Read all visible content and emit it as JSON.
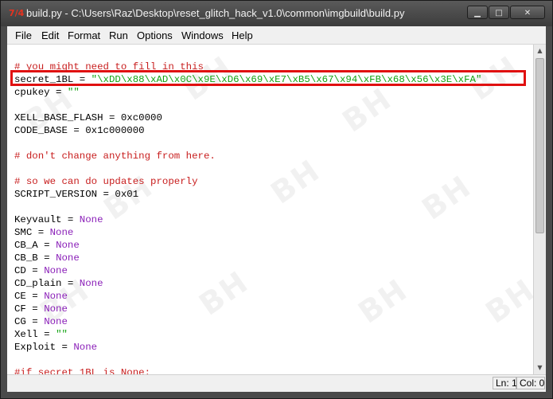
{
  "window": {
    "app_icon": "7/4",
    "title": "build.py - C:\\Users\\Raz\\Desktop\\reset_glitch_hack_v1.0\\common\\imgbuild\\build.py",
    "min_glyph": "▁",
    "max_glyph": "□",
    "close_glyph": "✕"
  },
  "menu": {
    "items": [
      "File",
      "Edit",
      "Format",
      "Run",
      "Options",
      "Windows",
      "Help"
    ]
  },
  "editor": {
    "lines": [
      [
        {
          "t": "# you might need to fill in this",
          "c": "com"
        }
      ],
      [
        {
          "t": "secret_1BL = ",
          "c": "def"
        },
        {
          "t": "\"\\xDD\\x88\\xAD\\x0C\\x9E\\xD6\\x69\\xE7\\xB5\\x67\\x94\\xFB\\x68\\x56\\x3E\\xFA\"",
          "c": "str"
        }
      ],
      [
        {
          "t": "cpukey = ",
          "c": "def"
        },
        {
          "t": "\"\"",
          "c": "str"
        }
      ],
      [],
      [
        {
          "t": "XELL_BASE_FLASH = 0xc0000",
          "c": "def"
        }
      ],
      [
        {
          "t": "CODE_BASE = 0x1c000000",
          "c": "def"
        }
      ],
      [],
      [
        {
          "t": "# don't change anything from here.",
          "c": "com"
        }
      ],
      [],
      [
        {
          "t": "# so we can do updates properly",
          "c": "com"
        }
      ],
      [
        {
          "t": "SCRIPT_VERSION = 0x01",
          "c": "def"
        }
      ],
      [],
      [
        {
          "t": "Keyvault = ",
          "c": "def"
        },
        {
          "t": "None",
          "c": "kw"
        }
      ],
      [
        {
          "t": "SMC = ",
          "c": "def"
        },
        {
          "t": "None",
          "c": "kw"
        }
      ],
      [
        {
          "t": "CB_A = ",
          "c": "def"
        },
        {
          "t": "None",
          "c": "kw"
        }
      ],
      [
        {
          "t": "CB_B = ",
          "c": "def"
        },
        {
          "t": "None",
          "c": "kw"
        }
      ],
      [
        {
          "t": "CD = ",
          "c": "def"
        },
        {
          "t": "None",
          "c": "kw"
        }
      ],
      [
        {
          "t": "CD_plain = ",
          "c": "def"
        },
        {
          "t": "None",
          "c": "kw"
        }
      ],
      [
        {
          "t": "CE = ",
          "c": "def"
        },
        {
          "t": "None",
          "c": "kw"
        }
      ],
      [
        {
          "t": "CF = ",
          "c": "def"
        },
        {
          "t": "None",
          "c": "kw"
        }
      ],
      [
        {
          "t": "CG = ",
          "c": "def"
        },
        {
          "t": "None",
          "c": "kw"
        }
      ],
      [
        {
          "t": "Xell = ",
          "c": "def"
        },
        {
          "t": "\"\"",
          "c": "str"
        }
      ],
      [
        {
          "t": "Exploit = ",
          "c": "def"
        },
        {
          "t": "None",
          "c": "kw"
        }
      ],
      [],
      [
        {
          "t": "#if secret_1BL is None:",
          "c": "com"
        }
      ]
    ],
    "highlighted_line": 1,
    "colors": {
      "def": "#000000",
      "com": "#c81e1e",
      "kw": "#8a1fb8",
      "str": "#12a312",
      "highlight": "#e01010"
    }
  },
  "scrollbar": {
    "up_glyph": "▲",
    "down_glyph": "▼"
  },
  "status": {
    "line": "Ln: 1",
    "col": "Col: 0"
  }
}
